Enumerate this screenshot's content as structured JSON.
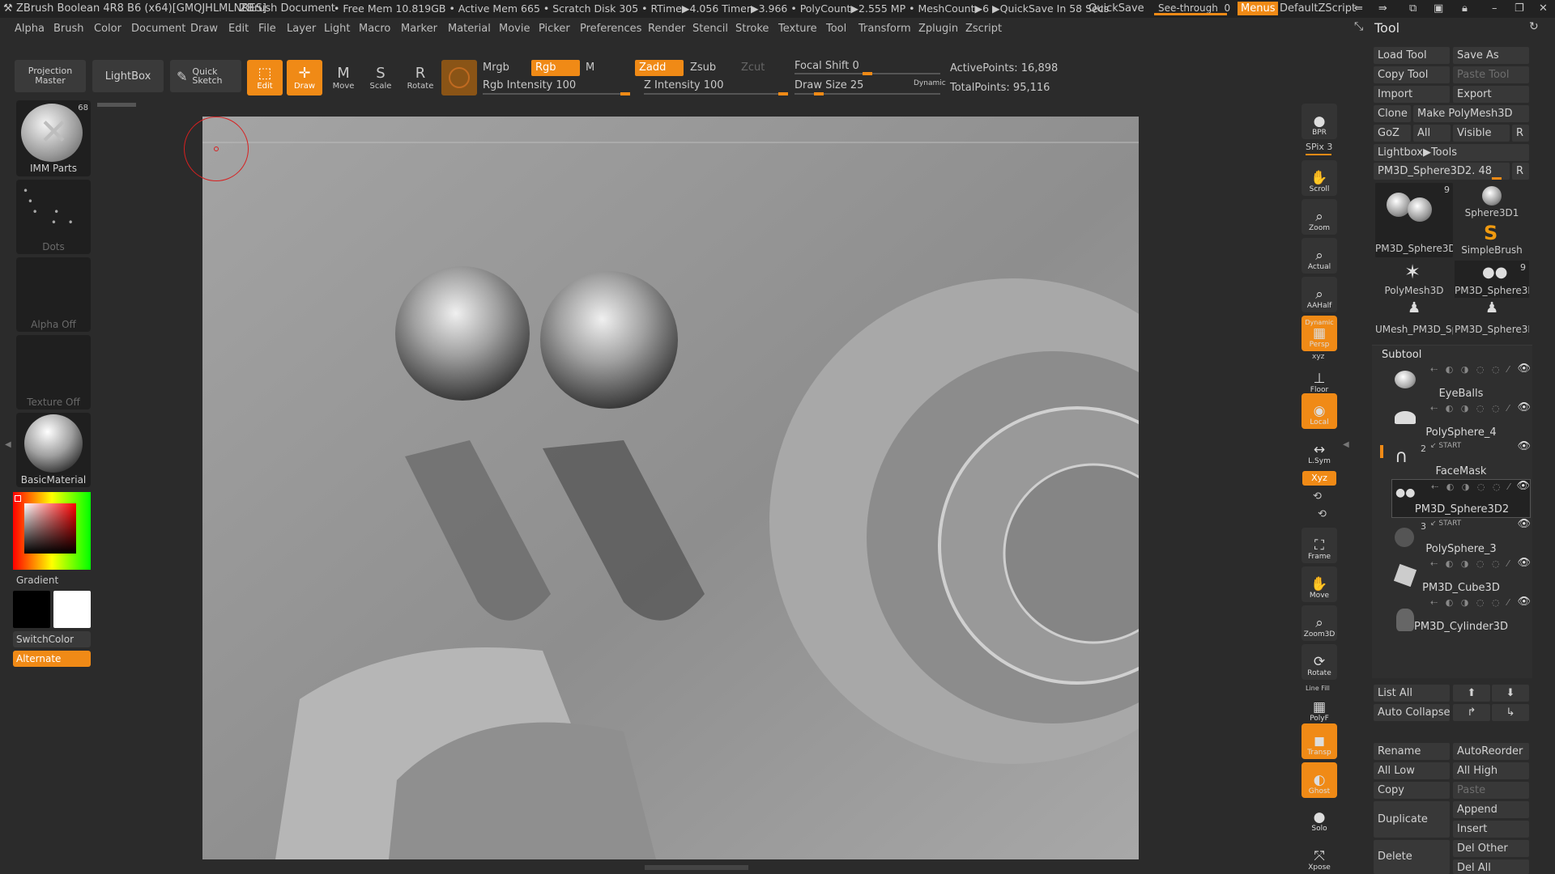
{
  "titlebar": {
    "app": "ZBrush Boolean 4R8 B6 (x64)[GMQJHLMLNRES]",
    "document": "ZBrush Document",
    "stats": "• Free Mem 10.819GB • Active Mem 665 • Scratch Disk 305 • RTime▶4.056 Timer▶3.966 • PolyCount▶2.555 MP • MeshCount▶6 ▶QuickSave In 58 Secs",
    "quicksave": "QuickSave",
    "see_through": "See-through",
    "see_through_value": "0",
    "menus": "Menus",
    "zscript": "DefaultZScript"
  },
  "menubar": [
    "Alpha",
    "Brush",
    "Color",
    "Document",
    "Draw",
    "Edit",
    "File",
    "Layer",
    "Light",
    "Macro",
    "Marker",
    "Material",
    "Movie",
    "Picker",
    "Preferences",
    "Render",
    "Stencil",
    "Stroke",
    "Texture",
    "Tool",
    "Transform",
    "Zplugin",
    "Zscript"
  ],
  "toolbar": {
    "projection_master": "Projection Master",
    "lightbox": "LightBox",
    "quick_sketch": "Quick Sketch",
    "edit": "Edit",
    "draw": "Draw",
    "move": "Move",
    "scale": "Scale",
    "rotate": "Rotate",
    "mrgb": "Mrgb",
    "rgb": "Rgb",
    "m": "M",
    "zadd": "Zadd",
    "zsub": "Zsub",
    "zcut": "Zcut",
    "rgb_intensity": "Rgb Intensity 100",
    "z_intensity": "Z Intensity 100",
    "focal_shift": "Focal Shift 0",
    "draw_size": "Draw Size 25",
    "dynamic": "Dynamic",
    "active_points": "ActivePoints: 16,898",
    "total_points": "TotalPoints: 95,116"
  },
  "leftshelf": {
    "brush_label": "IMM Parts",
    "brush_count": "68",
    "stroke_label": "Dots",
    "alpha_label": "Alpha Off",
    "texture_label": "Texture Off",
    "material_label": "BasicMaterial",
    "gradient_label": "Gradient",
    "switchcolor_label": "SwitchColor",
    "alternate_label": "Alternate"
  },
  "rightshelf": [
    "BPR",
    "SPix 3",
    "Scroll",
    "Zoom",
    "Actual",
    "AAHalf",
    "Persp",
    "Floor",
    "Local",
    "L.Sym",
    "Frame",
    "Move",
    "Zoom3D",
    "Rotate",
    "PolyF",
    "Transp",
    "Ghost",
    "Solo",
    "Xpose"
  ],
  "rightshelf_extra": {
    "dynamic": "Dynamic",
    "xyz": "xyz",
    "xyz2": "Xyz",
    "linefill": "Line Fill"
  },
  "toolpanel": {
    "title": "Tool",
    "buttons": {
      "load_tool": "Load Tool",
      "save_as": "Save As",
      "copy_tool": "Copy Tool",
      "paste_tool": "Paste Tool",
      "import": "Import",
      "export": "Export",
      "clone": "Clone",
      "make_polymesh": "Make PolyMesh3D",
      "goz": "GoZ",
      "all": "All",
      "visible": "Visible",
      "r": "R",
      "lightbox_tools": "Lightbox▶Tools",
      "current_tool": "PM3D_Sphere3D2. 48",
      "r2": "R"
    },
    "thumbs": [
      {
        "label": "PM3D_Sphere3D",
        "count": "9"
      },
      {
        "label": "Sphere3D1"
      },
      {
        "label": "SimpleBrush"
      },
      {
        "label": "PolyMesh3D"
      },
      {
        "label": "PM3D_Sphere3D",
        "count": "9"
      },
      {
        "label": "UMesh_PM3D_Sp"
      },
      {
        "label": "PM3D_Sphere3D"
      }
    ],
    "subtool_title": "Subtool",
    "subtools": [
      {
        "name": "EyeBalls"
      },
      {
        "name": "PolySphere_4"
      },
      {
        "name": "FaceMask",
        "num": "2",
        "start": "START"
      },
      {
        "name": "PM3D_Sphere3D2"
      },
      {
        "name": "PolySphere_3",
        "num": "3",
        "start": "START"
      },
      {
        "name": "PM3D_Cube3D"
      },
      {
        "name": "PM3D_Cylinder3D"
      }
    ],
    "list_all": "List All",
    "auto_collapse": "Auto Collapse",
    "rename": "Rename",
    "autoreorder": "AutoReorder",
    "all_low": "All Low",
    "all_high": "All High",
    "copy": "Copy",
    "paste": "Paste",
    "duplicate": "Duplicate",
    "append": "Append",
    "insert": "Insert",
    "delete": "Delete",
    "del_other": "Del Other",
    "del_all": "Del All"
  }
}
